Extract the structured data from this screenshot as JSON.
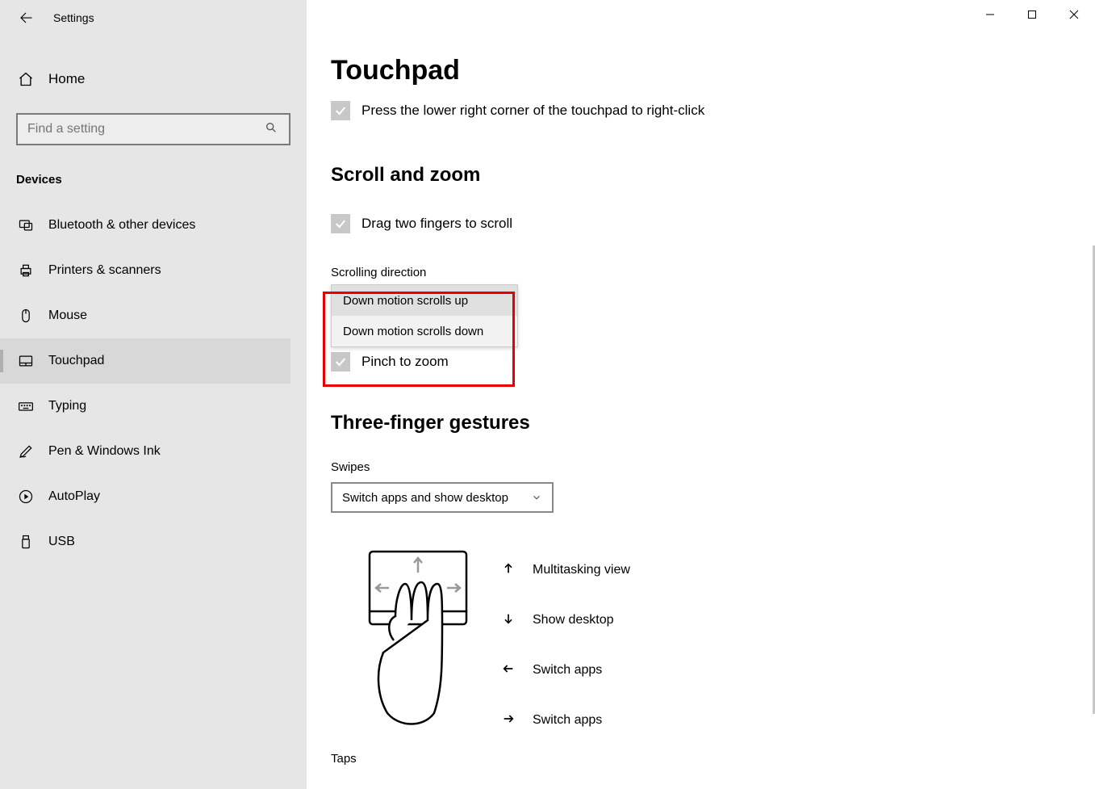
{
  "window": {
    "title": "Settings"
  },
  "sidebar": {
    "home_label": "Home",
    "search_placeholder": "Find a setting",
    "section_label": "Devices",
    "items": [
      {
        "label": "Bluetooth & other devices"
      },
      {
        "label": "Printers & scanners"
      },
      {
        "label": "Mouse"
      },
      {
        "label": "Touchpad"
      },
      {
        "label": "Typing"
      },
      {
        "label": "Pen & Windows Ink"
      },
      {
        "label": "AutoPlay"
      },
      {
        "label": "USB"
      }
    ],
    "selected_index": 3
  },
  "main": {
    "page_title": "Touchpad",
    "top_check_label": "Press the lower right corner of the touchpad to right-click",
    "scroll_zoom_title": "Scroll and zoom",
    "drag_scroll_label": "Drag two fingers to scroll",
    "scrolling_direction_label": "Scrolling direction",
    "scrolling_options": [
      "Down motion scrolls up",
      "Down motion scrolls down"
    ],
    "pinch_label": "Pinch to zoom",
    "three_finger_title": "Three-finger gestures",
    "swipes_label": "Swipes",
    "swipes_value": "Switch apps and show desktop",
    "gestures": [
      {
        "dir": "up",
        "label": "Multitasking view"
      },
      {
        "dir": "down",
        "label": "Show desktop"
      },
      {
        "dir": "left",
        "label": "Switch apps"
      },
      {
        "dir": "right",
        "label": "Switch apps"
      }
    ],
    "taps_label": "Taps"
  }
}
